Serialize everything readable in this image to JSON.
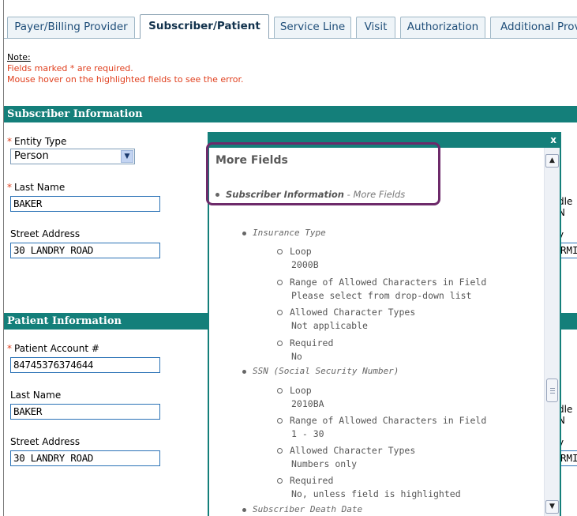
{
  "tabs": [
    {
      "label": "Payer/Billing Provider",
      "active": false
    },
    {
      "label": "Subscriber/Patient",
      "active": true
    },
    {
      "label": "Service Line",
      "active": false
    },
    {
      "label": "Visit",
      "active": false
    },
    {
      "label": "Authorization",
      "active": false
    },
    {
      "label": "Additional Provi",
      "active": false
    }
  ],
  "note": {
    "title": "Note:",
    "lines": [
      "Fields marked * are required.",
      "Mouse hover on the highlighted fields to see the error."
    ]
  },
  "subscriber": {
    "header": "Subscriber Information",
    "entity_type_label": "Entity Type",
    "entity_type_value": "Person",
    "last_name_label": "Last Name",
    "last_name_value": "BAKER",
    "street_label": "Street Address",
    "street_value": "30 LANDRY ROAD",
    "cut_label_1": "dle N",
    "cut_label_2": "y",
    "cut_value_2": "RMI"
  },
  "patient": {
    "header": "Patient Information",
    "account_label": "Patient Account #",
    "account_value": "84745376374644",
    "last_name_label": "Last Name",
    "last_name_value": "BAKER",
    "street_label": "Street Address",
    "street_value": "30 LANDRY ROAD",
    "cut_label_1": "dle N",
    "cut_label_2": "y",
    "cut_value_2": "RMI"
  },
  "popup": {
    "close": "x",
    "title": "More Fields",
    "section_name": "Subscriber Information",
    "section_suffix": " - More Fields",
    "fields": [
      {
        "name": "Insurance Type",
        "items": [
          {
            "label": "Loop",
            "value": "2000B"
          },
          {
            "label": "Range of Allowed Characters in Field",
            "value": "Please select from drop-down list"
          },
          {
            "label": "Allowed Character Types",
            "value": "Not applicable"
          },
          {
            "label": "Required",
            "value": "No"
          }
        ]
      },
      {
        "name": "SSN (Social Security Number)",
        "items": [
          {
            "label": "Loop",
            "value": "2010BA"
          },
          {
            "label": "Range of Allowed Characters in Field",
            "value": "1 - 30"
          },
          {
            "label": "Allowed Character Types",
            "value": "Numbers only"
          },
          {
            "label": "Required",
            "value": "No, unless field is highlighted"
          }
        ]
      },
      {
        "name": "Subscriber Death Date",
        "items": []
      }
    ]
  },
  "icons": {
    "dropdown": "chevron-down-icon",
    "scroll_up": "scroll-up-icon",
    "scroll_down": "scroll-down-icon",
    "close": "close-icon"
  },
  "colors": {
    "section_header": "#147f7a",
    "required": "#e0401f",
    "highlight_box": "#6d2a6a",
    "tab_text": "#1f4e79"
  }
}
